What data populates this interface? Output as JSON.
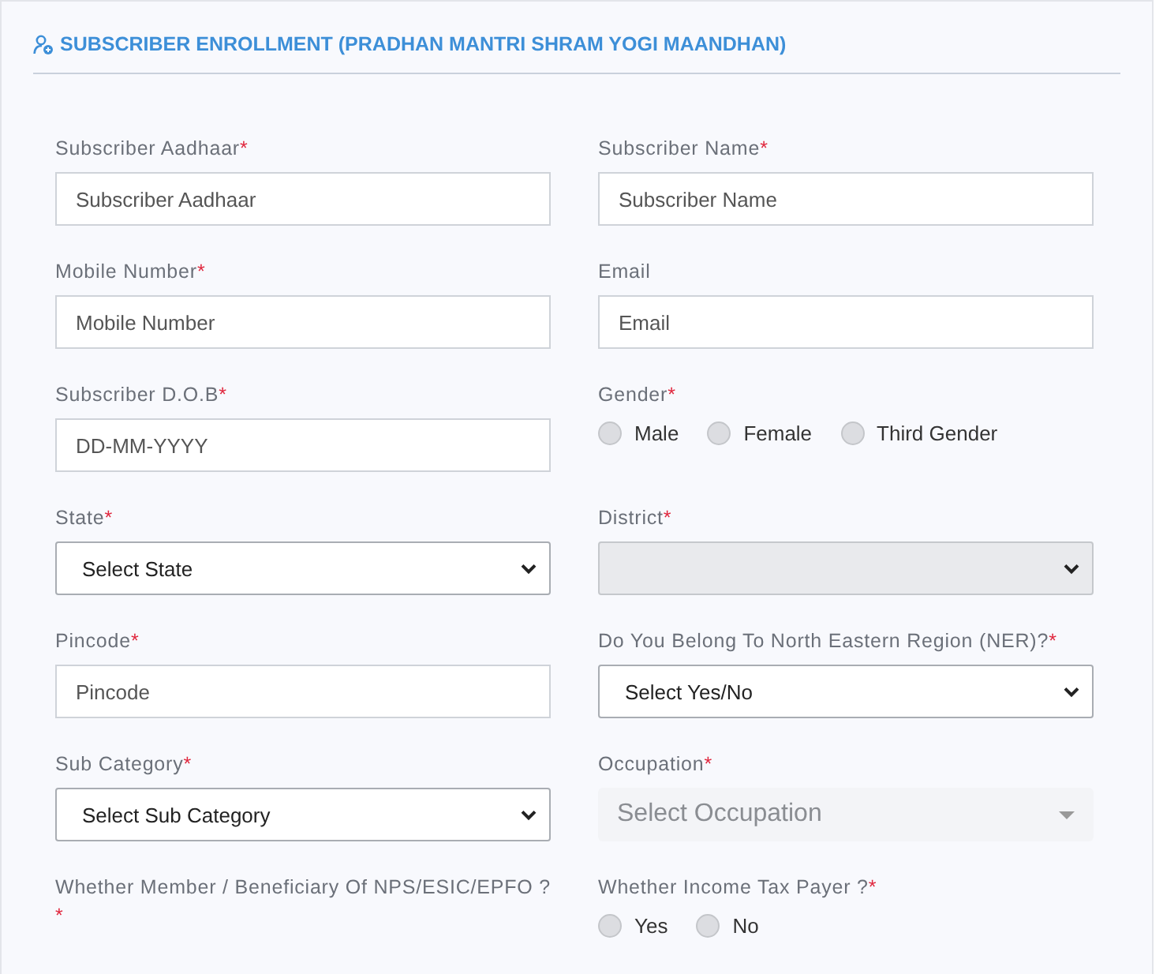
{
  "title": "SUBSCRIBER ENROLLMENT (PRADHAN MANTRI SHRAM YOGI MAANDHAN)",
  "fields": [
    {
      "kind": "input",
      "label": "Subscriber Aadhaar",
      "mark": "*",
      "placeholder": "Subscriber Aadhaar"
    },
    {
      "kind": "input",
      "label": "Subscriber Name",
      "mark": "*",
      "placeholder": "Subscriber Name"
    },
    {
      "kind": "input",
      "label": "Mobile Number",
      "mark": "*",
      "placeholder": "Mobile Number"
    },
    {
      "kind": "input",
      "label": "Email",
      "placeholder": "Email"
    },
    {
      "kind": "input",
      "label": "Subscriber D.O.B",
      "mark": "*",
      "placeholder": "DD-MM-YYYY"
    },
    {
      "kind": "radio",
      "label": "Gender",
      "mark": "*",
      "options": [
        {
          "label": "Male",
          "selected": false
        },
        {
          "label": "Female",
          "selected": false
        },
        {
          "label": "Third Gender",
          "selected": false
        }
      ]
    },
    {
      "kind": "select",
      "label": "State",
      "mark": "*",
      "value": "Select State",
      "disabled": false
    },
    {
      "kind": "select",
      "label": "District",
      "mark": "*",
      "disabled": true
    },
    {
      "kind": "input",
      "label": "Pincode",
      "mark": "*",
      "placeholder": "Pincode"
    },
    {
      "kind": "select",
      "label": "Do You Belong To North Eastern Region (NER)?",
      "mark": "*",
      "value": "Select Yes/No",
      "disabled": false
    },
    {
      "kind": "select",
      "label": "Sub Category",
      "mark": "*",
      "value": "Select Sub Category",
      "disabled": false
    },
    {
      "kind": "combo",
      "label": "Occupation",
      "mark": "*",
      "placeholder": "Select Occupation"
    },
    {
      "kind": "label",
      "label": "Whether Member / Beneficiary Of NPS/ESIC/EPFO ?",
      "mark": "*"
    },
    {
      "kind": "radio",
      "label": "Whether Income Tax Payer ?",
      "mark": "*",
      "options": [
        {
          "label": "Yes",
          "selected": false
        },
        {
          "label": "No",
          "selected": false
        }
      ]
    }
  ]
}
